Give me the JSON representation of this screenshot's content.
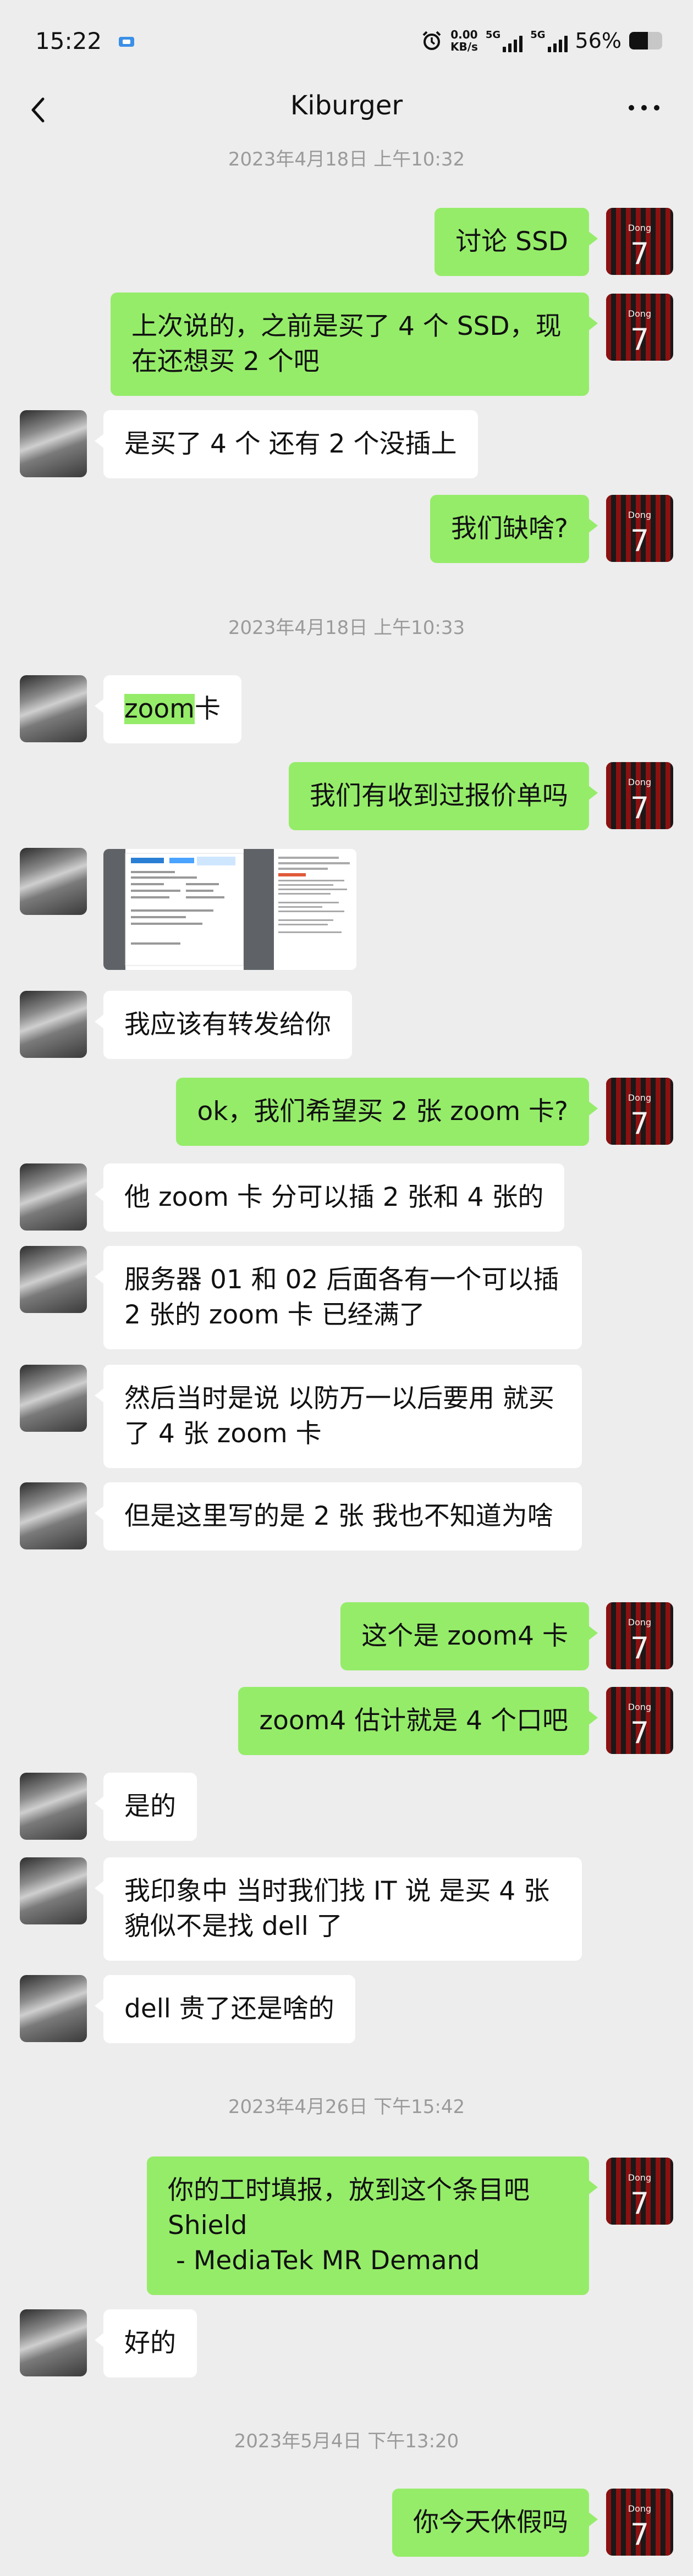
{
  "status": {
    "time": "15:22",
    "net_speed_value": "0.00",
    "net_speed_unit": "KB/s",
    "sim1": "5G",
    "sim2": "5G",
    "battery": "56%",
    "battery_level": 0.56
  },
  "header": {
    "title": "Kiburger"
  },
  "avatars": {
    "self_name": "Dong",
    "self_number": "7"
  },
  "colors": {
    "self_bubble": "#95ec69",
    "other_bubble": "#ffffff",
    "background": "#ededed",
    "timestamp": "#9a9a9a"
  },
  "messages": [
    {
      "type": "timestamp",
      "text": "2023年4月18日 上午10:32"
    },
    {
      "from": "self",
      "text": "讨论 SSD"
    },
    {
      "from": "self",
      "text": "上次说的，之前是买了 4 个 SSD，现在还想买 2 个吧"
    },
    {
      "from": "other",
      "text": "是买了 4 个 还有 2 个没插上"
    },
    {
      "from": "self",
      "text": "我们缺啥?"
    },
    {
      "type": "timestamp",
      "text": "2023年4月18日 上午10:33"
    },
    {
      "from": "other",
      "text_highlight": "zoom",
      "text": "卡"
    },
    {
      "from": "self",
      "text": "我们有收到过报价单吗"
    },
    {
      "from": "other",
      "type": "image"
    },
    {
      "from": "other",
      "text": "我应该有转发给你"
    },
    {
      "from": "self",
      "text": "ok，我们希望买 2 张 zoom 卡?"
    },
    {
      "from": "other",
      "text": "他 zoom 卡 分可以插 2 张和 4 张的"
    },
    {
      "from": "other",
      "text": "服务器 01 和 02 后面各有一个可以插 2 张的 zoom 卡 已经满了"
    },
    {
      "from": "other",
      "text": "然后当时是说 以防万一以后要用 就买了 4 张 zoom 卡"
    },
    {
      "from": "other",
      "text": "但是这里写的是 2 张 我也不知道为啥"
    },
    {
      "from": "self",
      "text": "这个是 zoom4 卡"
    },
    {
      "from": "self",
      "text": "zoom4 估计就是 4 个口吧"
    },
    {
      "from": "other",
      "text": "是的"
    },
    {
      "from": "other",
      "text": "我印象中 当时我们找 IT 说 是买 4 张 貌似不是找 dell 了"
    },
    {
      "from": "other",
      "text": "dell 贵了还是啥的"
    },
    {
      "type": "timestamp",
      "text": "2023年4月26日 下午15:42"
    },
    {
      "from": "self",
      "text": "你的工时填报，放到这个条目吧\nShield\n - MediaTek MR Demand"
    },
    {
      "from": "other",
      "text": "好的"
    },
    {
      "type": "timestamp",
      "text": "2023年5月4日 下午13:20"
    },
    {
      "from": "self",
      "text": "你今天休假吗"
    }
  ]
}
